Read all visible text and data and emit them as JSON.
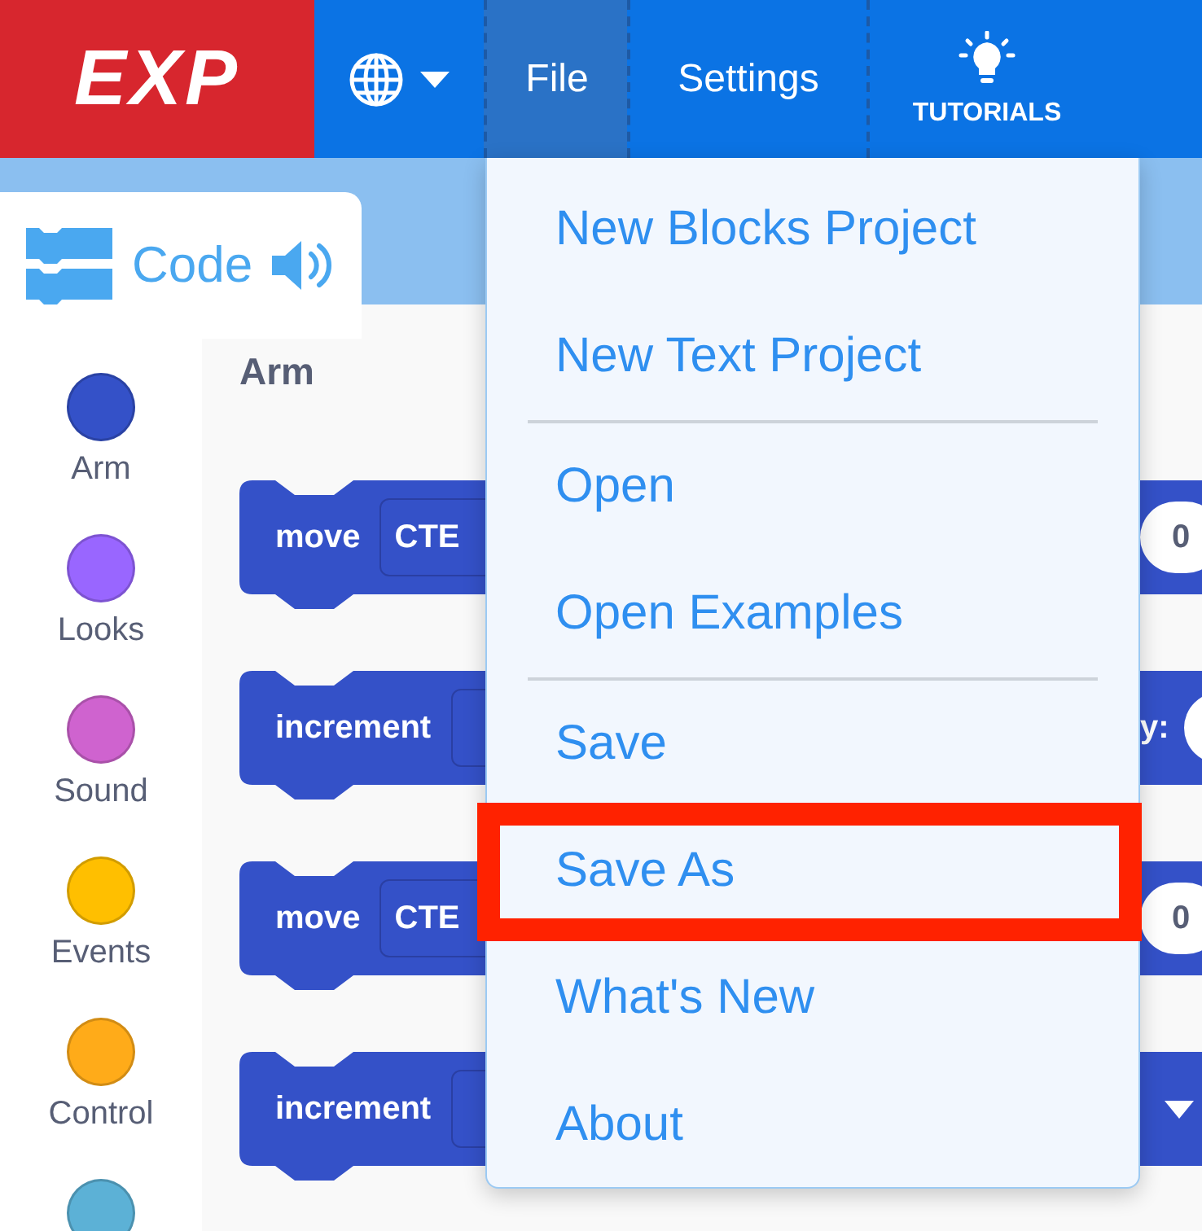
{
  "header": {
    "logo": "EXP",
    "menus": [
      {
        "kind": "language",
        "selected": false
      },
      {
        "kind": "text",
        "label": "File",
        "selected": true
      },
      {
        "kind": "text",
        "label": "Settings",
        "selected": false
      },
      {
        "kind": "tutorials",
        "label": "TUTORIALS",
        "selected": false
      }
    ]
  },
  "tab": {
    "label": "Code"
  },
  "categories": [
    {
      "label": "Arm",
      "color": "#3451c8"
    },
    {
      "label": "Looks",
      "color": "#9966ff"
    },
    {
      "label": "Sound",
      "color": "#cf63cf"
    },
    {
      "label": "Events",
      "color": "#ffbf00"
    },
    {
      "label": "Control",
      "color": "#ffab19"
    },
    {
      "color": "#5cb1d6"
    }
  ],
  "palette": {
    "title": "Arm",
    "blocks": [
      {
        "label": "move",
        "field": "CTE",
        "tail": {
          "kind": "pill",
          "text": "0"
        }
      },
      {
        "label": "increment",
        "tail": {
          "kind": "label_pill",
          "text": "y:"
        }
      },
      {
        "label": "move",
        "field": "CTE",
        "tail": {
          "kind": "pill",
          "text": "0"
        }
      },
      {
        "label": "increment",
        "tail": {
          "kind": "dropdown"
        }
      }
    ]
  },
  "file_menu": [
    {
      "kind": "item",
      "label": "New Blocks Project",
      "highlighted": false
    },
    {
      "kind": "item",
      "label": "New Text Project",
      "highlighted": false
    },
    {
      "kind": "divider"
    },
    {
      "kind": "item",
      "label": "Open",
      "highlighted": false
    },
    {
      "kind": "item",
      "label": "Open Examples",
      "highlighted": false
    },
    {
      "kind": "divider"
    },
    {
      "kind": "item",
      "label": "Save",
      "highlighted": false
    },
    {
      "kind": "item",
      "label": "Save As",
      "highlighted": true
    },
    {
      "kind": "item",
      "label": "What's New",
      "highlighted": false
    },
    {
      "kind": "item",
      "label": "About",
      "highlighted": false
    }
  ]
}
